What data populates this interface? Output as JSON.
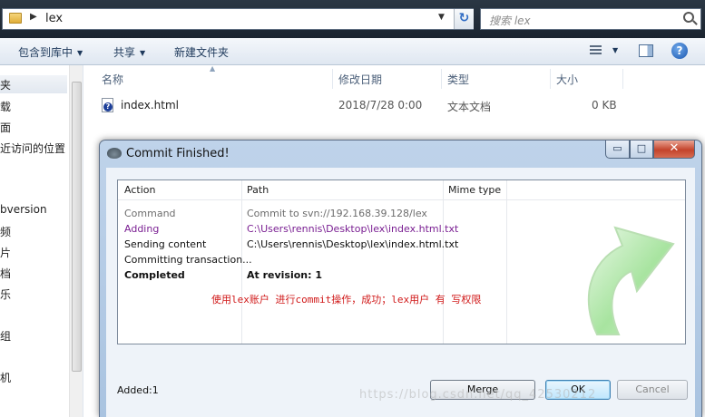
{
  "explorer": {
    "address_path": "lex",
    "search_placeholder": "搜索 lex",
    "toolbar": {
      "include_library": "包含到库中",
      "share": "共享",
      "new_folder": "新建文件夹"
    },
    "nav_items": [
      "夹",
      "载",
      "面",
      "近访问的位置",
      "bversion",
      "频",
      "片",
      "档",
      "乐",
      "组",
      "机"
    ],
    "columns": [
      "名称",
      "修改日期",
      "类型",
      "大小"
    ],
    "files": [
      {
        "name": "index.html",
        "modified": "2018/7/28 0:00",
        "type": "文本文档",
        "size": "0 KB"
      }
    ]
  },
  "dialog": {
    "title": "Commit Finished!",
    "window_buttons": {
      "minimize": "▭",
      "maximize": "□",
      "close": "✕"
    },
    "columns": [
      "Action",
      "Path",
      "Mime type"
    ],
    "rows": [
      {
        "action": "Command",
        "path": "Commit to svn://192.168.39.128/lex",
        "style": "gray"
      },
      {
        "action": "Adding",
        "path": "C:\\Users\\rennis\\Desktop\\lex\\index.html.txt",
        "style": "purple"
      },
      {
        "action": "Sending content",
        "path": "C:\\Users\\rennis\\Desktop\\lex\\index.html.txt",
        "style": "black"
      },
      {
        "action": "Committing transaction...",
        "path": "",
        "style": "black"
      },
      {
        "action": "Completed",
        "path": "At revision: 1",
        "style": "bold"
      }
    ],
    "annotation": "使用lex账户 进行commit操作，成功；lex用户 有 写权限",
    "status": "Added:1",
    "buttons": {
      "merge": "Merge",
      "ok": "OK",
      "cancel": "Cancel"
    }
  },
  "watermark": "https://blog.csdn.net/qq_42530212",
  "colors": {
    "accent_green": "#7fd07f",
    "annotation_red": "#d01818",
    "title_bar": "#b9cfe8"
  }
}
